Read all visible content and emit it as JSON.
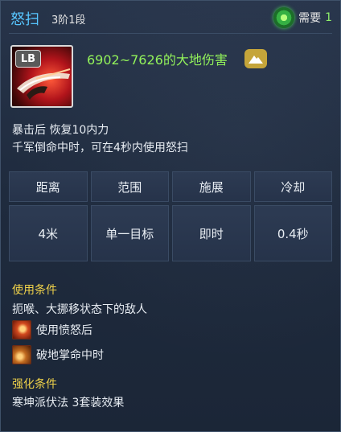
{
  "skill": {
    "name": "怒扫",
    "rank": "3阶1段",
    "need_label": "需要",
    "need_count": "1",
    "icon_badge": "LB",
    "damage": "6902~7626的大地伤害",
    "element_icon": "mountain-icon"
  },
  "description": [
    "暴击后 恢复10内力",
    "千军倒命中时，可在4秒内使用怒扫"
  ],
  "stats": {
    "headers": [
      "距离",
      "范围",
      "施展",
      "冷却"
    ],
    "values": [
      "4米",
      "单一目标",
      "即时",
      "0.4秒"
    ]
  },
  "use_conditions": {
    "title": "使用条件",
    "line": "扼喉、大挪移状态下的敌人",
    "items": [
      {
        "label": "使用愤怒后",
        "icon": "rage-buff-icon"
      },
      {
        "label": "破地掌命中时",
        "icon": "earth-palm-buff-icon"
      }
    ]
  },
  "enhance_conditions": {
    "title": "强化条件",
    "line": "寒坤派伏法 3套装效果"
  },
  "colors": {
    "skill_name": "#57c6ff",
    "damage": "#92f25a",
    "section_title": "#f0d24a",
    "need_count": "#8ff06a"
  }
}
